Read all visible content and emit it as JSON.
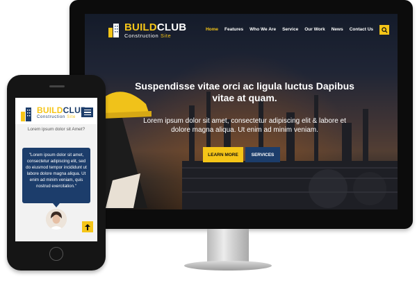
{
  "brand": {
    "primary": "BUILD",
    "secondary": "CLUB",
    "tagline_start": "Construction ",
    "tagline_end": "Site"
  },
  "colors": {
    "accent": "#f5c518",
    "navy": "#1c3d6b",
    "monitor_bezel": "#0c0c0c"
  },
  "desktop": {
    "nav": [
      "Home",
      "Features",
      "Who We Are",
      "Service",
      "Our Work",
      "News",
      "Contact Us"
    ],
    "active_nav": "Home",
    "search_icon": "search-icon",
    "hero": {
      "title": "Suspendisse vitae orci ac ligula luctus Dapibus vitae at quam.",
      "subtitle": "Lorem ipsum dolor sit amet, consectetur adipiscing elit & labore et dolore magna aliqua. Ut enim ad minim veniam.",
      "learn_more": "LEARN MORE",
      "services": "SERVICES"
    }
  },
  "mobile": {
    "menu_icon": "hamburger-menu-icon",
    "question": "Lorem ipsum dolor sit Amet?",
    "testimonial": "\"Lorem ipsum dolor sit amet, consectetur adipiscing elit, sed do eiusmod tempor incididunt ut labore dolore magna aliqua. Ut enim ad minim veniam, quis nostrud exercitation.\"",
    "scroll_top_icon": "arrow-up-icon"
  }
}
